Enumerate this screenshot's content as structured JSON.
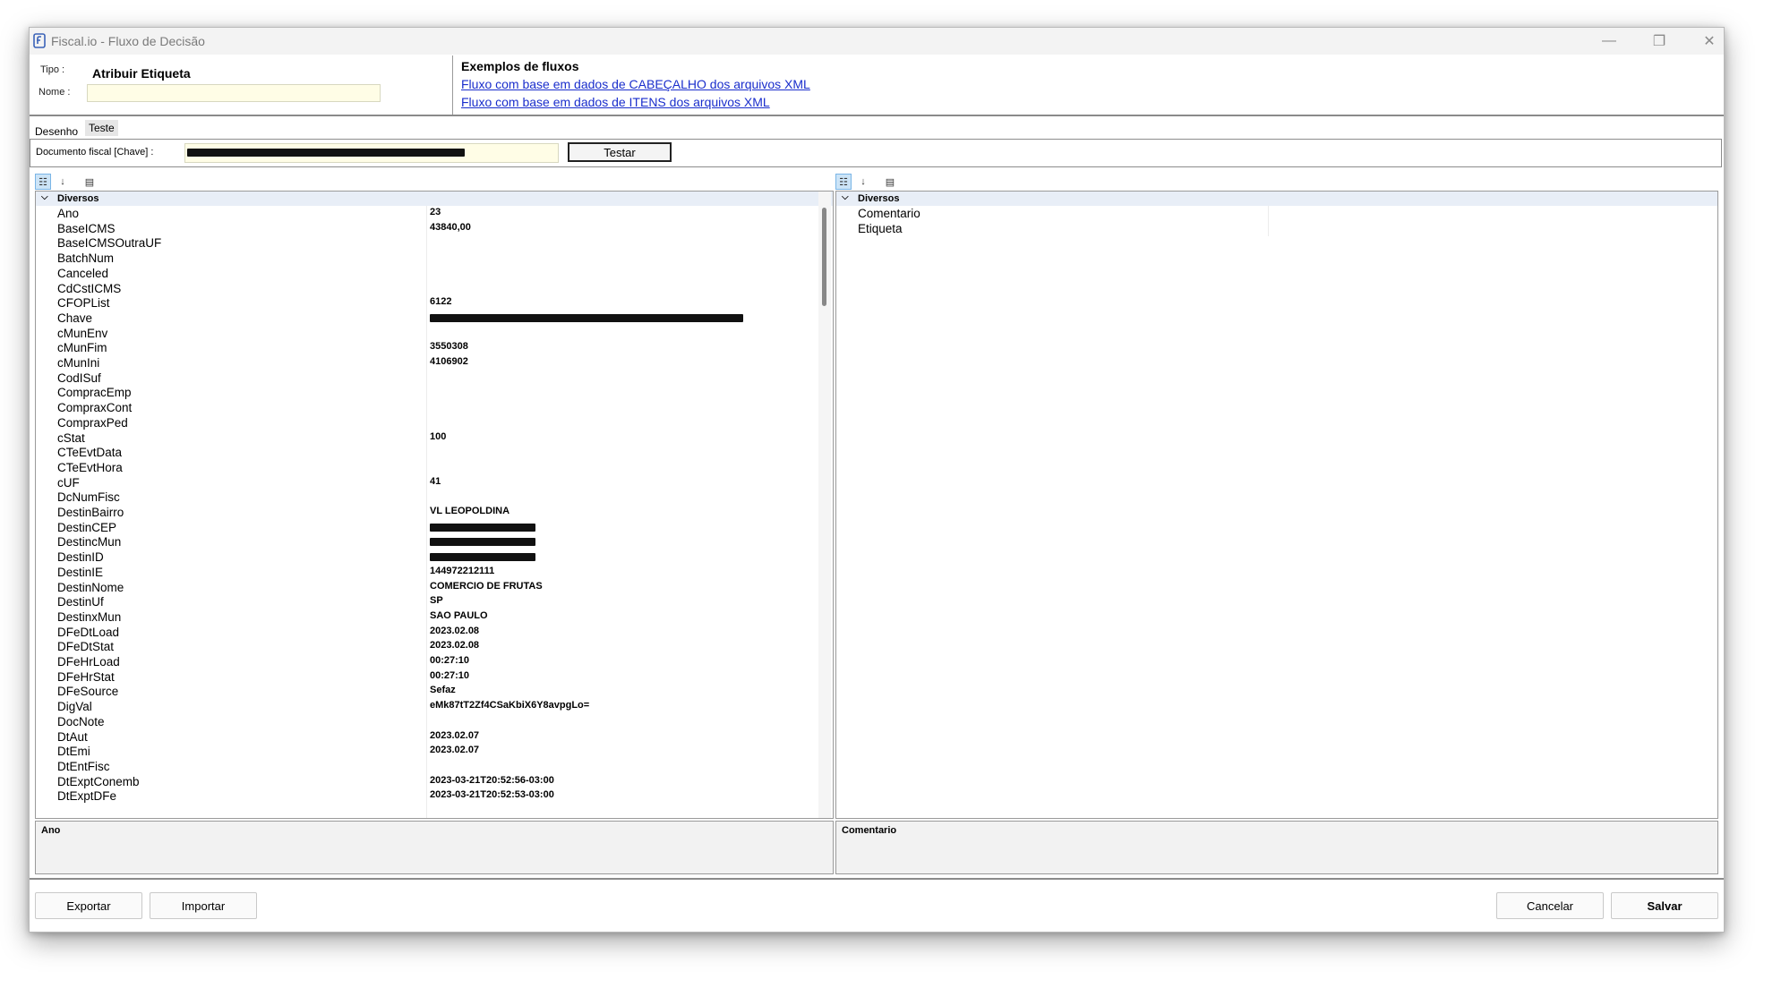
{
  "window": {
    "title": "Fiscal.io - Fluxo de Decisão",
    "controls": {
      "minimize": "—",
      "restore": "❐",
      "close": "✕"
    }
  },
  "header": {
    "tipo_label": "Tipo :",
    "tipo_value": "Atribuir Etiqueta",
    "nome_label": "Nome :",
    "nome_value": "",
    "examples_title": "Exemplos de fluxos",
    "link_cabecalho": "Fluxo com base em dados de CABEÇALHO dos arquivos XML",
    "link_itens": "Fluxo com base em dados de ITENS dos arquivos XML"
  },
  "tabs": [
    {
      "label": "Desenho",
      "active": false
    },
    {
      "label": "Teste",
      "active": true
    }
  ],
  "teste": {
    "doc_label": "Documento fiscal [Chave] :",
    "testar_label": "Testar"
  },
  "toolbar_icons": [
    "categorized-icon",
    "alphabetical-sort-icon",
    "property-pages-icon"
  ],
  "left_grid": {
    "category": "Diversos",
    "rows": [
      {
        "name": "Ano",
        "value": "23"
      },
      {
        "name": "BaseICMS",
        "value": "43840,00"
      },
      {
        "name": "BaseICMSOutraUF",
        "value": ""
      },
      {
        "name": "BatchNum",
        "value": ""
      },
      {
        "name": "Canceled",
        "value": ""
      },
      {
        "name": "CdCstICMS",
        "value": ""
      },
      {
        "name": "CFOPList",
        "value": "6122"
      },
      {
        "name": "Chave",
        "value": "",
        "redacted": true
      },
      {
        "name": "cMunEnv",
        "value": ""
      },
      {
        "name": "cMunFim",
        "value": "3550308"
      },
      {
        "name": "cMunIni",
        "value": "4106902"
      },
      {
        "name": "CodISuf",
        "value": ""
      },
      {
        "name": "ComprасEmp",
        "value": ""
      },
      {
        "name": "CompraxCont",
        "value": ""
      },
      {
        "name": "CompraxPed",
        "value": ""
      },
      {
        "name": "cStat",
        "value": "100"
      },
      {
        "name": "CTeEvtData",
        "value": ""
      },
      {
        "name": "CTeEvtHora",
        "value": ""
      },
      {
        "name": "cUF",
        "value": "41"
      },
      {
        "name": "DcNumFisc",
        "value": ""
      },
      {
        "name": "DestinBairro",
        "value": "VL LEOPOLDINA"
      },
      {
        "name": "DestinCEP",
        "value": "",
        "redacted": true
      },
      {
        "name": "DestincMun",
        "value": "",
        "redacted": true
      },
      {
        "name": "DestinID",
        "value": "",
        "redacted": true
      },
      {
        "name": "DestinIE",
        "value": "144972212111"
      },
      {
        "name": "DestinNome",
        "value": "COMERCIO DE FRUTAS"
      },
      {
        "name": "DestinUf",
        "value": "SP"
      },
      {
        "name": "DestinxMun",
        "value": "SAO PAULO"
      },
      {
        "name": "DFeDtLoad",
        "value": "2023.02.08"
      },
      {
        "name": "DFeDtStat",
        "value": "2023.02.08"
      },
      {
        "name": "DFeHrLoad",
        "value": "00:27:10"
      },
      {
        "name": "DFeHrStat",
        "value": "00:27:10"
      },
      {
        "name": "DFeSource",
        "value": "Sefaz"
      },
      {
        "name": "DigVal",
        "value": "eMk87tT2Zf4CSaKbiX6Y8avpgLo="
      },
      {
        "name": "DocNote",
        "value": ""
      },
      {
        "name": "DtAut",
        "value": "2023.02.07"
      },
      {
        "name": "DtEmi",
        "value": "2023.02.07"
      },
      {
        "name": "DtEntFisc",
        "value": ""
      },
      {
        "name": "DtExptConemb",
        "value": "2023-03-21T20:52:56-03:00"
      },
      {
        "name": "DtExptDFe",
        "value": "2023-03-21T20:52:53-03:00"
      }
    ],
    "description_title": "Ano"
  },
  "right_grid": {
    "category": "Diversos",
    "rows": [
      {
        "name": "Comentario",
        "value": ""
      },
      {
        "name": "Etiqueta",
        "value": ""
      }
    ],
    "description_title": "Comentario"
  },
  "footer": {
    "exportar": "Exportar",
    "importar": "Importar",
    "cancelar": "Cancelar",
    "salvar": "Salvar"
  }
}
